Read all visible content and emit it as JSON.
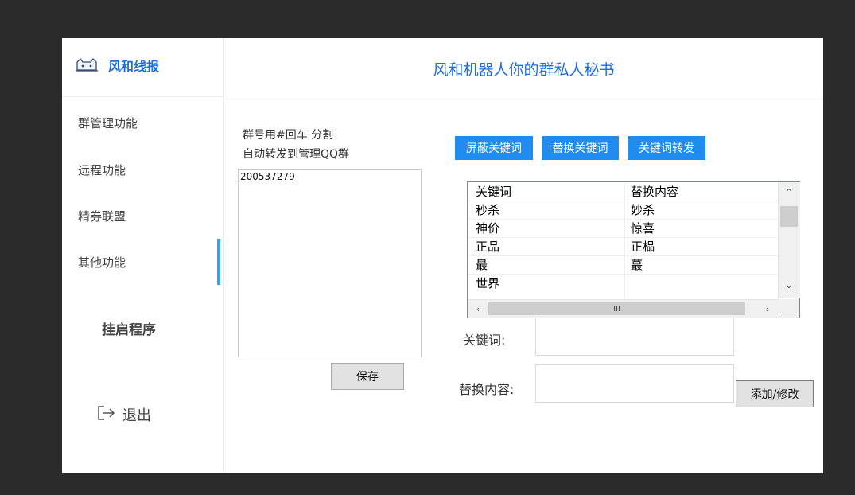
{
  "brand": {
    "label": "风和线报"
  },
  "header": {
    "title": "风和机器人你的群私人秘书"
  },
  "sidebar": {
    "items": [
      {
        "label": "群管理功能"
      },
      {
        "label": "远程功能"
      },
      {
        "label": "精券联盟"
      },
      {
        "label": "其他功能"
      }
    ],
    "launch": "挂启程序",
    "logout": "退出"
  },
  "group_panel": {
    "hint_line1": "群号用#回车 分割",
    "hint_line2": "自动转发到管理QQ群",
    "groups_value": "200537279",
    "save_label": "保存"
  },
  "keyword_buttons": [
    "屏蔽关键词",
    "替换关键词",
    "关键词转发"
  ],
  "table": {
    "headers": [
      "关键词",
      "替换内容"
    ],
    "rows": [
      [
        "秒杀",
        "妙杀"
      ],
      [
        "神价",
        "惊喜"
      ],
      [
        "正品",
        "正榀"
      ],
      [
        "最",
        "蕞"
      ],
      [
        "世界",
        ""
      ]
    ],
    "hscroll_thumb": "III"
  },
  "form": {
    "keyword_label": "关键词:",
    "keyword_value": "",
    "replace_label": "替换内容:",
    "replace_value": "",
    "add_label": "添加/修改"
  },
  "colors": {
    "accent": "#1e6fd9",
    "button_blue": "#1e8cf0",
    "active_bar": "#2ea3f2",
    "background": "#2b2b2b"
  }
}
